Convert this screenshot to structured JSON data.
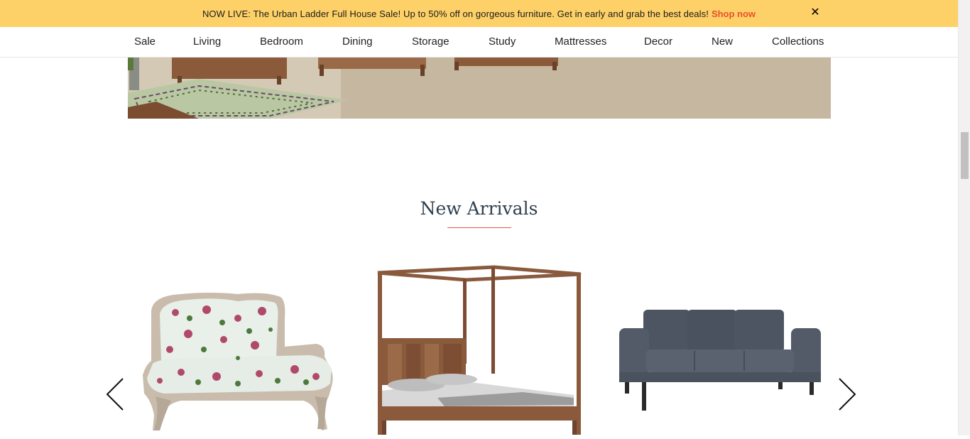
{
  "announcement": {
    "message": "NOW LIVE: The Urban Ladder Full House Sale! Up to 50% off on gorgeous furniture. Get in early and grab the best deals!",
    "link_label": "Shop now",
    "close_label": "✕"
  },
  "nav": {
    "items": [
      {
        "label": "Sale"
      },
      {
        "label": "Living"
      },
      {
        "label": "Bedroom"
      },
      {
        "label": "Dining"
      },
      {
        "label": "Storage"
      },
      {
        "label": "Study"
      },
      {
        "label": "Mattresses"
      },
      {
        "label": "Decor"
      },
      {
        "label": "New"
      },
      {
        "label": "Collections"
      }
    ]
  },
  "section": {
    "title": "New Arrivals"
  },
  "colors": {
    "announce_bg": "#fed168",
    "accent": "#e8502a",
    "title": "#2e3f4e"
  },
  "carousel": {
    "prev_icon": "chevron-left-icon",
    "next_icon": "chevron-right-icon",
    "products": [
      {
        "icon": "floral-loveseat-image"
      },
      {
        "icon": "canopy-bed-image"
      },
      {
        "icon": "grey-sofa-image"
      }
    ]
  }
}
